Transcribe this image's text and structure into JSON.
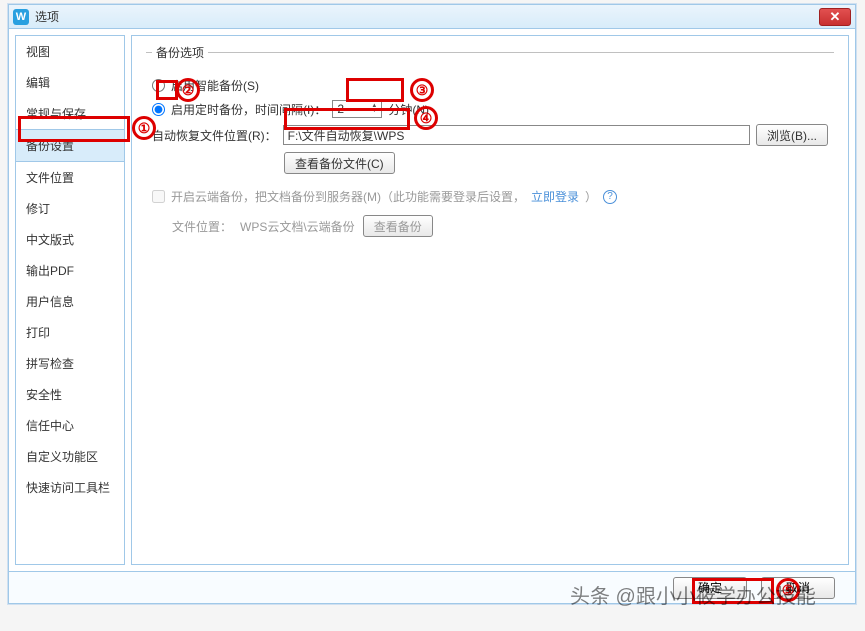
{
  "titlebar": {
    "app_icon_text": "W",
    "title": "选项"
  },
  "sidebar": {
    "items": [
      {
        "label": "视图"
      },
      {
        "label": "编辑"
      },
      {
        "label": "常规与保存"
      },
      {
        "label": "备份设置"
      },
      {
        "label": "文件位置"
      },
      {
        "label": "修订"
      },
      {
        "label": "中文版式"
      },
      {
        "label": "输出PDF"
      },
      {
        "label": "用户信息"
      },
      {
        "label": "打印"
      },
      {
        "label": "拼写检查"
      },
      {
        "label": "安全性"
      },
      {
        "label": "信任中心"
      },
      {
        "label": "自定义功能区"
      },
      {
        "label": "快速访问工具栏"
      }
    ],
    "selected_index": 3
  },
  "content": {
    "legend": "备份选项",
    "smart_backup": {
      "label": "启用智能备份(S)",
      "checked": false
    },
    "timed_backup": {
      "label_prefix": "启用定时备份，时间间隔(I)：",
      "value": "2",
      "unit": "分钟(N)",
      "checked": true
    },
    "recover_path": {
      "label": "自动恢复文件位置(R)：",
      "value": "F:\\文件自动恢复\\WPS",
      "browse": "浏览(B)..."
    },
    "view_backup_btn": "查看备份文件(C)",
    "cloud": {
      "label": "开启云端备份，把文档备份到服务器(M)（此功能需要登录后设置，",
      "login_link": "立即登录",
      "tail": "）",
      "checked": false
    },
    "cloud_location": {
      "prefix": "文件位置：",
      "path": "WPS云文档\\云端备份",
      "btn": "查看备份"
    }
  },
  "footer": {
    "ok": "确定",
    "cancel": "取消"
  },
  "annotations": {
    "c1": "①",
    "c2": "②",
    "c3": "③",
    "c4": "④",
    "c5": "⑤"
  },
  "watermark": "头条 @跟小小筱学办公技能"
}
